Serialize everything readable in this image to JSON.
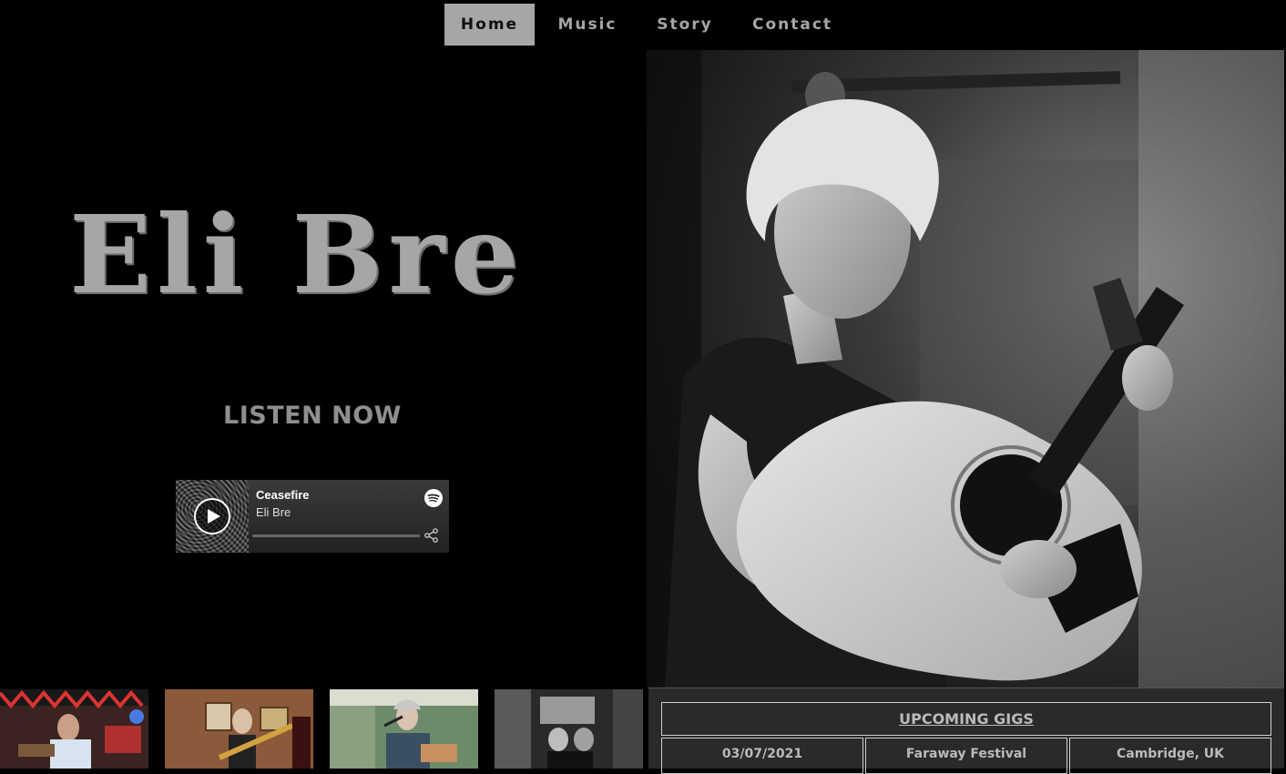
{
  "nav": {
    "items": [
      {
        "label": "Home",
        "active": true
      },
      {
        "label": "Music",
        "active": false
      },
      {
        "label": "Story",
        "active": false
      },
      {
        "label": "Contact",
        "active": false
      }
    ]
  },
  "hero_left": {
    "artist_name": "Eli Bre",
    "listen_label": "LISTEN NOW"
  },
  "player": {
    "track_title": "Ceasefire",
    "track_artist": "Eli Bre",
    "provider_icon": "spotify-icon",
    "play_icon": "play-icon",
    "share_icon": "share-icon"
  },
  "gigs": {
    "title": "UPCOMING GIGS",
    "rows": [
      {
        "date": "03/07/2021",
        "event": "Faraway Festival",
        "location": "Cambridge, UK"
      }
    ]
  },
  "colors": {
    "background": "#000000",
    "accent_gray": "#a6a6a6",
    "panel": "#2a2a2a"
  }
}
